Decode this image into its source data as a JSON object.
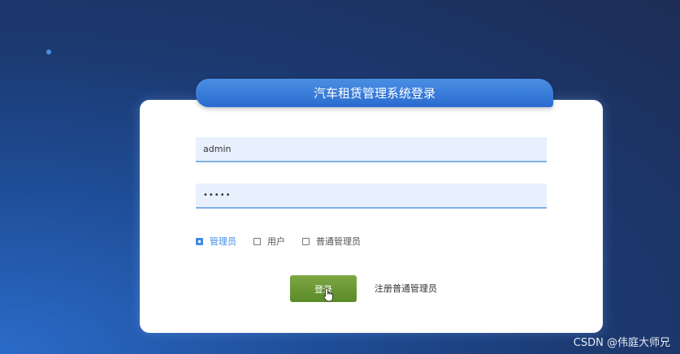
{
  "login": {
    "title": "汽车租赁管理系统登录",
    "username_value": "admin",
    "password_value": "•••••",
    "roles": [
      {
        "label": "管理员",
        "checked": true
      },
      {
        "label": "用户",
        "checked": false
      },
      {
        "label": "普通管理员",
        "checked": false
      }
    ],
    "login_label": "登录",
    "register_label": "注册普通管理员"
  },
  "watermark": "CSDN @伟庭大师兄",
  "colors": {
    "accent": "#3f8be6",
    "login_button": "#6c9a35",
    "title_tab": "#3a7fd9"
  }
}
